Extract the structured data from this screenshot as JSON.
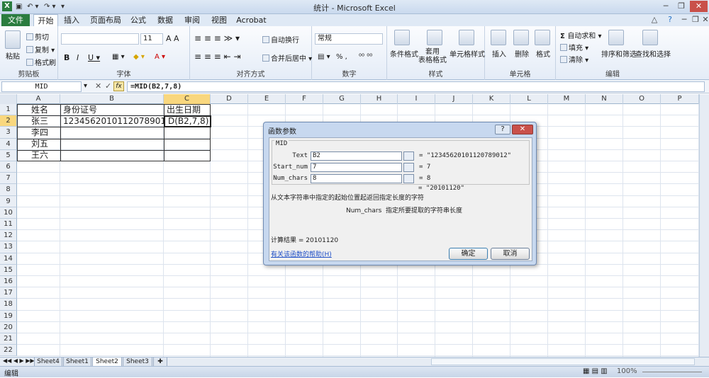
{
  "window": {
    "title": "统计 - Microsoft Excel"
  },
  "tabs": [
    "文件",
    "开始",
    "插入",
    "页面布局",
    "公式",
    "数据",
    "审阅",
    "视图",
    "Acrobat"
  ],
  "ribbon": {
    "clipboard": {
      "paste": "粘贴",
      "cut": "剪切",
      "copy": "复制 ▾",
      "format_painter": "格式刷",
      "label": "剪贴板"
    },
    "font": {
      "size": "11",
      "label": "字体",
      "bold": "B",
      "italic": "I",
      "underline": "U ▾"
    },
    "alignment": {
      "wrap": "自动换行",
      "merge": "合并后居中 ▾",
      "label": "对齐方式"
    },
    "number": {
      "format": "常规",
      "label": "数字",
      "percent": "% ,"
    },
    "styles": {
      "cond": "条件格式",
      "table": "套用\n表格格式",
      "cell": "单元格样式",
      "label": "样式"
    },
    "cells": {
      "insert": "插入",
      "delete": "删除",
      "format": "格式",
      "label": "单元格"
    },
    "editing": {
      "autosum": "自动求和 ▾",
      "fill": "填充 ▾",
      "clear": "清除 ▾",
      "sort": "排序和筛选",
      "find": "查找和选择",
      "label": "编辑"
    }
  },
  "formula_bar": {
    "name_box": "MID",
    "fx": "fx",
    "formula": "=MID(B2,7,8)"
  },
  "columns": [
    "A",
    "B",
    "C",
    "D",
    "E",
    "F",
    "G",
    "H",
    "I",
    "J",
    "K",
    "L",
    "M",
    "N",
    "O",
    "P"
  ],
  "rows": [
    "1",
    "2",
    "3",
    "4",
    "5",
    "6",
    "7",
    "8",
    "9",
    "10",
    "11",
    "12",
    "13",
    "14",
    "15",
    "16",
    "17",
    "18",
    "19",
    "20",
    "21",
    "22"
  ],
  "cells": {
    "A1": "姓名",
    "B1": "身份证号",
    "C1": "出生日期",
    "A2": "张三",
    "B2": "12345620101120789012",
    "C2": "D(B2,7,8)",
    "A3": "李四",
    "A4": "刘五",
    "A5": "王六"
  },
  "dialog": {
    "title": "函数参数",
    "function": "MID",
    "args": [
      {
        "name": "Text",
        "value": "B2",
        "result": "= \"12345620101120789012\""
      },
      {
        "name": "Start_num",
        "value": "7",
        "result": "= 7"
      },
      {
        "name": "Num_chars",
        "value": "8",
        "result": "= 8"
      }
    ],
    "overall_result": "= \"20101120\"",
    "description": "从文本字符串中指定的起始位置起返回指定长度的字符",
    "arg_help": "Num_chars  指定所要提取的字符串长度",
    "calc_result": "计算结果 =  20101120",
    "help_link": "有关该函数的帮助(H)",
    "ok": "确定",
    "cancel": "取消"
  },
  "sheet_tabs": [
    "Sheet4",
    "Sheet1",
    "Sheet2",
    "Sheet3"
  ],
  "active_sheet": "Sheet2",
  "status": {
    "mode": "编辑",
    "zoom": "100%"
  },
  "colors": {
    "highlight_box": "#e3262b",
    "excel_green": "#2a7c3f",
    "selected_header": "#f9d77e"
  }
}
